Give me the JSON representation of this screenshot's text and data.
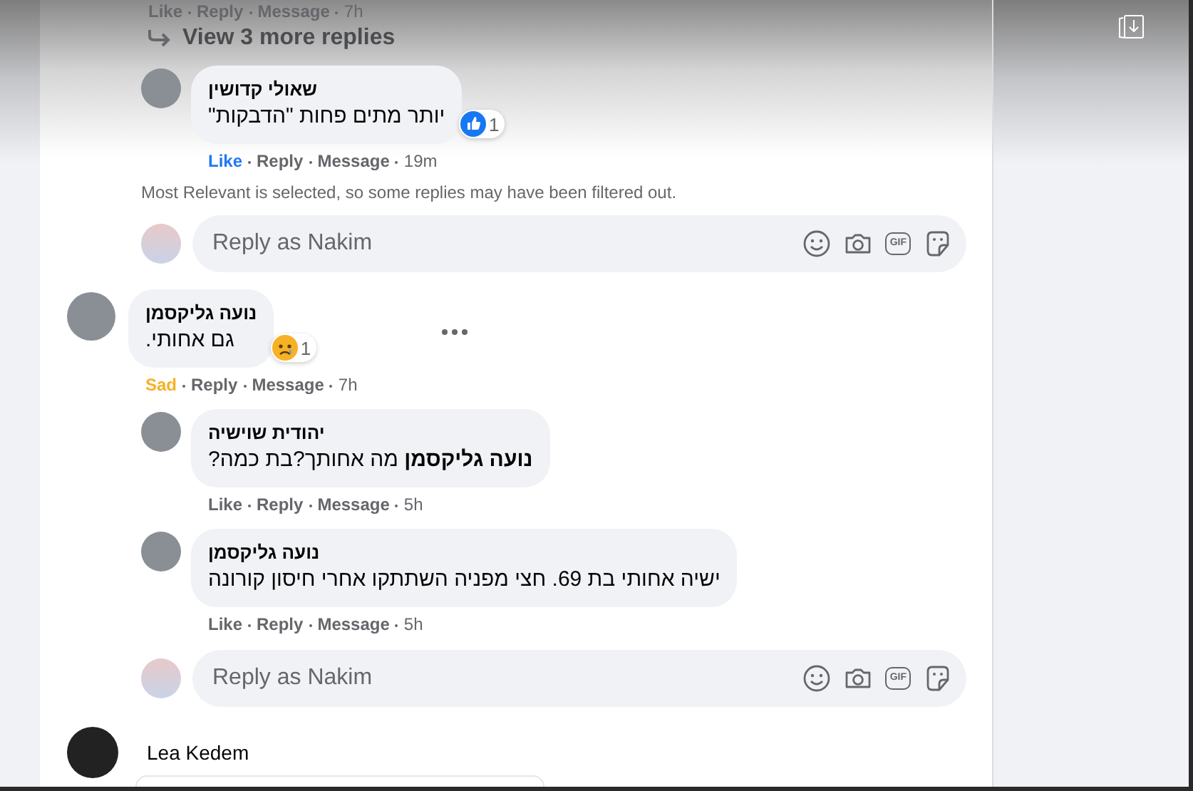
{
  "comments": [
    {
      "kind": "tail",
      "actions": [
        {
          "label": "Like",
          "active": false
        },
        {
          "label": "Reply"
        },
        {
          "label": "Message"
        }
      ],
      "time": "7h",
      "view_more": "View 3 more replies",
      "replies": [
        {
          "author": "שאולי קדושין",
          "text": "יותר מתים פחות \"הדבקות\"",
          "reaction": {
            "kind": "like",
            "count": "1"
          },
          "actions": [
            {
              "label": "Like",
              "active": true
            },
            {
              "label": "Reply"
            },
            {
              "label": "Message"
            }
          ],
          "time": "19m"
        }
      ],
      "filter_note": "Most Relevant is selected, so some replies may have been filtered out.",
      "reply_box": {
        "placeholder": "Reply as Nakim",
        "gif": "GIF"
      }
    },
    {
      "kind": "full",
      "author": "נועה גליקסמן",
      "text": "גם אחותי.",
      "reaction": {
        "kind": "sad",
        "count": "1"
      },
      "actions": [
        {
          "label": "Sad",
          "kind": "sad",
          "active": true
        },
        {
          "label": "Reply"
        },
        {
          "label": "Message"
        }
      ],
      "time": "7h",
      "replies": [
        {
          "author": "יהודית שוישיה",
          "text": "**נועה גליקסמן** מה אחותך?בת כמה?",
          "actions": [
            {
              "label": "Like",
              "active": false
            },
            {
              "label": "Reply"
            },
            {
              "label": "Message"
            }
          ],
          "time": "5h"
        },
        {
          "author": "נועה גליקסמן",
          "text": "ישיה אחותי בת 69. חצי מפניה השתתקו אחרי חיסון קורונה",
          "actions": [
            {
              "label": "Like",
              "active": false
            },
            {
              "label": "Reply"
            },
            {
              "label": "Message"
            }
          ],
          "time": "5h"
        }
      ],
      "reply_box": {
        "placeholder": "Reply as Nakim",
        "gif": "GIF"
      }
    },
    {
      "kind": "header",
      "author": "Lea Kedem"
    }
  ]
}
